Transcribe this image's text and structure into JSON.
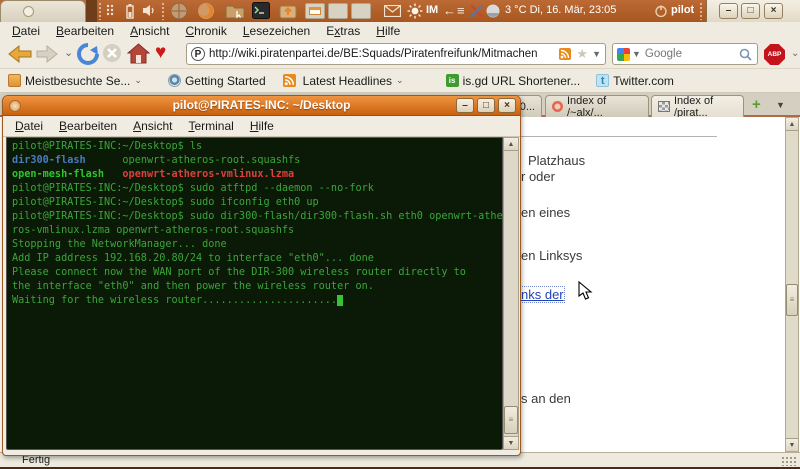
{
  "panel": {
    "im": "IM",
    "clock": "3 °C Di, 16. Mär, 23:05",
    "user": "pilot"
  },
  "colors": {
    "panel_orange": "#b05f2a",
    "titlebar_orange": "#d97a1e",
    "terminal_bg": "#0b1a07",
    "terminal_green": "#3aa53a",
    "terminal_blue_dir": "#4a7ac2",
    "terminal_bright_green": "#2fc42f",
    "terminal_red": "#e03e3e",
    "link_blue": "#2244bb"
  },
  "browser": {
    "menu": [
      {
        "label": "Datei",
        "accel": 0
      },
      {
        "label": "Bearbeiten",
        "accel": 0
      },
      {
        "label": "Ansicht",
        "accel": 0
      },
      {
        "label": "Chronik",
        "accel": 0
      },
      {
        "label": "Lesezeichen",
        "accel": 0
      },
      {
        "label": "Extras",
        "accel": 1
      },
      {
        "label": "Hilfe",
        "accel": 0
      }
    ],
    "url": "http://wiki.piratenpartei.de/BE:Squads/Piratenfreifunk/Mitmachen",
    "search_placeholder": "Google",
    "adblock_label": "ABP",
    "bookmarks": [
      {
        "label": "Meistbesuchte Se..."
      },
      {
        "label": "Getting Started"
      },
      {
        "label": "Latest Headlines"
      },
      {
        "label": "is.gd URL Shortener..."
      },
      {
        "label": "Twitter.com"
      }
    ],
    "tabs": [
      {
        "label": "0..."
      },
      {
        "label": "Index of /~alx/..."
      },
      {
        "label": "Index of /pirat..."
      }
    ],
    "fragments": {
      "f0": "Platzhaus",
      "f1": "r oder",
      "f2": "en eines",
      "f3": "en Linksys",
      "f4": "nks der",
      "f5": "s an den"
    },
    "status": "Fertig",
    "isgd_icon_text": "is",
    "twitter_icon_text": "t",
    "newtab_glyph": "+"
  },
  "terminal": {
    "title": "pilot@PIRATES-INC: ~/Desktop",
    "menu": [
      {
        "label": "Datei",
        "accel": 0
      },
      {
        "label": "Bearbeiten",
        "accel": 0
      },
      {
        "label": "Ansicht",
        "accel": 0
      },
      {
        "label": "Terminal",
        "accel": 0
      },
      {
        "label": "Hilfe",
        "accel": 0
      }
    ],
    "lines": [
      [
        [
          "t",
          "pilot@PIRATES-INC:~/Desktop$ ls"
        ]
      ],
      [
        [
          "d",
          "dir300-flash"
        ],
        [
          "t",
          "      "
        ],
        [
          "t",
          "openwrt-atheros-root.squashfs"
        ]
      ],
      [
        [
          "x",
          "open-mesh-flash"
        ],
        [
          "t",
          "   "
        ],
        [
          "r",
          "openwrt-atheros-vmlinux.lzma"
        ]
      ],
      [
        [
          "t",
          "pilot@PIRATES-INC:~/Desktop$ sudo atftpd --daemon --no-fork"
        ]
      ],
      [
        [
          "t",
          "pilot@PIRATES-INC:~/Desktop$ sudo ifconfig eth0 up"
        ]
      ],
      [
        [
          "t",
          "pilot@PIRATES-INC:~/Desktop$ sudo dir300-flash/dir300-flash.sh eth0 openwrt-athe"
        ]
      ],
      [
        [
          "t",
          "ros-vmlinux.lzma openwrt-atheros-root.squashfs"
        ]
      ],
      [
        [
          "t",
          "Stopping the NetworkManager... done"
        ]
      ],
      [
        [
          "t",
          "Add IP address 192.168.20.80/24 to interface \"eth0\"... done"
        ]
      ],
      [
        [
          "t",
          "Please connect now the WAN port of the DIR-300 wireless router directly to"
        ]
      ],
      [
        [
          "t",
          "the interface \"eth0\" and then power the wireless router on."
        ]
      ],
      [
        [
          "t",
          "Waiting for the wireless router......................"
        ],
        [
          "c",
          " "
        ]
      ]
    ]
  }
}
